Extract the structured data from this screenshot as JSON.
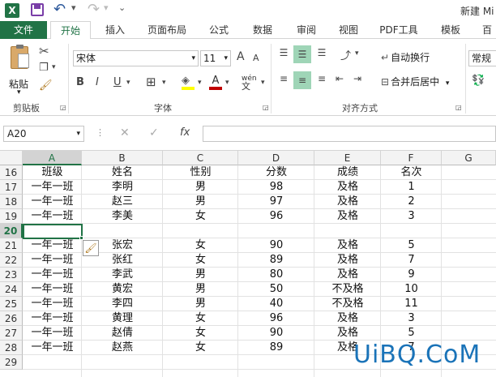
{
  "window": {
    "title": "新建 Mi"
  },
  "qat": {
    "excel_letter": "X",
    "save": "💾",
    "undo": "↶",
    "redo": "↷",
    "more": "⌄"
  },
  "tabs": [
    {
      "label": "文件",
      "active": false,
      "file": true
    },
    {
      "label": "开始",
      "active": true
    },
    {
      "label": "插入"
    },
    {
      "label": "页面布局"
    },
    {
      "label": "公式"
    },
    {
      "label": "数据"
    },
    {
      "label": "审阅"
    },
    {
      "label": "视图"
    },
    {
      "label": "PDF工具"
    },
    {
      "label": "模板"
    },
    {
      "label": "百"
    }
  ],
  "ribbon": {
    "paste_label": "粘贴",
    "clipboard_label": "剪贴板",
    "font_name": "宋体",
    "font_size": "11",
    "font_label": "字体",
    "bold": "B",
    "italic": "I",
    "underline": "U",
    "wen_label": "wén",
    "wrap_text": "自动换行",
    "merge_center": "合并后居中",
    "alignment_label": "对齐方式",
    "number_format": "常规",
    "grow_font": "A",
    "shrink_font": "A"
  },
  "formula_bar": {
    "name_box": "A20",
    "fx": "fx",
    "formula": ""
  },
  "columns": [
    "A",
    "B",
    "C",
    "D",
    "E",
    "F",
    "G"
  ],
  "rows": [
    {
      "num": "16",
      "cells": [
        "班级",
        "姓名",
        "性别",
        "分数",
        "成绩",
        "名次"
      ]
    },
    {
      "num": "17",
      "cells": [
        "一年一班",
        "李明",
        "男",
        "98",
        "及格",
        "1"
      ]
    },
    {
      "num": "18",
      "cells": [
        "一年一班",
        "赵三",
        "男",
        "97",
        "及格",
        "2"
      ]
    },
    {
      "num": "19",
      "cells": [
        "一年一班",
        "李美",
        "女",
        "96",
        "及格",
        "3"
      ]
    },
    {
      "num": "20",
      "cells": [
        "",
        "",
        "",
        "",
        "",
        ""
      ]
    },
    {
      "num": "21",
      "cells": [
        "一年一班",
        "张宏",
        "女",
        "90",
        "及格",
        "5"
      ]
    },
    {
      "num": "22",
      "cells": [
        "一年一班",
        "张红",
        "女",
        "89",
        "及格",
        "7"
      ]
    },
    {
      "num": "23",
      "cells": [
        "一年一班",
        "李武",
        "男",
        "80",
        "及格",
        "9"
      ]
    },
    {
      "num": "24",
      "cells": [
        "一年一班",
        "黄宏",
        "男",
        "50",
        "不及格",
        "10"
      ]
    },
    {
      "num": "25",
      "cells": [
        "一年一班",
        "李四",
        "男",
        "40",
        "不及格",
        "11"
      ]
    },
    {
      "num": "26",
      "cells": [
        "一年一班",
        "黄理",
        "女",
        "96",
        "及格",
        "3"
      ]
    },
    {
      "num": "27",
      "cells": [
        "一年一班",
        "赵倩",
        "女",
        "90",
        "及格",
        "5"
      ]
    },
    {
      "num": "28",
      "cells": [
        "一年一班",
        "赵燕",
        "女",
        "89",
        "及格",
        "7"
      ]
    },
    {
      "num": "29",
      "cells": [
        "",
        "",
        "",
        "",
        "",
        ""
      ]
    }
  ],
  "watermark": "UiBQ.CoM",
  "colors": {
    "excel_green": "#217346",
    "selection_green": "#217346",
    "accent_red": "#c00000"
  }
}
